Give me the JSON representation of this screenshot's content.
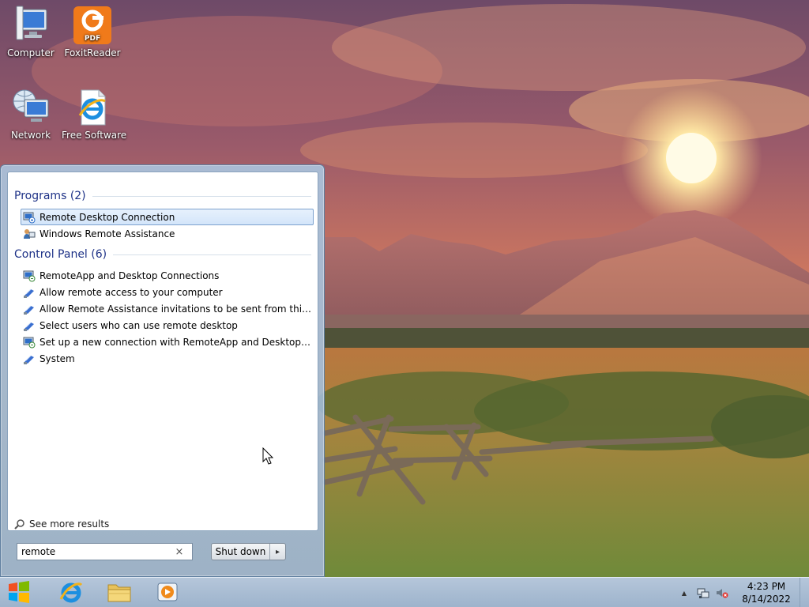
{
  "desktop": {
    "icons": [
      {
        "label": "Computer",
        "icon": "computer-icon"
      },
      {
        "label": "FoxitReader",
        "icon": "pdf-reader-icon"
      },
      {
        "label": "Network",
        "icon": "network-icon"
      },
      {
        "label": "Free Software",
        "icon": "internet-explorer-icon"
      }
    ],
    "foxit_badge": "PDF"
  },
  "start_menu": {
    "groups": [
      {
        "title": "Programs (2)",
        "items": [
          {
            "label": "Remote Desktop Connection",
            "icon": "remote-desktop-icon",
            "selected": true
          },
          {
            "label": "Windows Remote Assistance",
            "icon": "remote-assistance-icon",
            "selected": false
          }
        ]
      },
      {
        "title": "Control Panel (6)",
        "items": [
          {
            "label": "RemoteApp and Desktop Connections",
            "icon": "remoteapp-icon"
          },
          {
            "label": "Allow remote access to your computer",
            "icon": "control-panel-icon"
          },
          {
            "label": "Allow Remote Assistance invitations to be sent from this comp...",
            "icon": "control-panel-icon"
          },
          {
            "label": "Select users who can use remote desktop",
            "icon": "control-panel-icon"
          },
          {
            "label": "Set up a new connection with RemoteApp and Desktop Conne...",
            "icon": "remoteapp-icon"
          },
          {
            "label": "System",
            "icon": "control-panel-icon"
          }
        ]
      }
    ],
    "see_more": "See more results",
    "search": {
      "value": "remote",
      "clear_glyph": "×"
    },
    "shutdown": {
      "label": "Shut down",
      "arrow_glyph": "▸"
    }
  },
  "taskbar": {
    "pinned": [
      "start-orb-icon",
      "internet-explorer-icon",
      "file-explorer-icon",
      "media-player-icon"
    ],
    "tray": {
      "overflow_glyph": "▲",
      "icons": [
        "network-tray-icon",
        "volume-muted-icon"
      ]
    },
    "clock": {
      "time": "4:23 PM",
      "date": "8/14/2022"
    }
  },
  "colors": {
    "group_heading": "#1e3287",
    "selection_border": "#7da2ce",
    "taskbar": "#a9c0d8"
  }
}
